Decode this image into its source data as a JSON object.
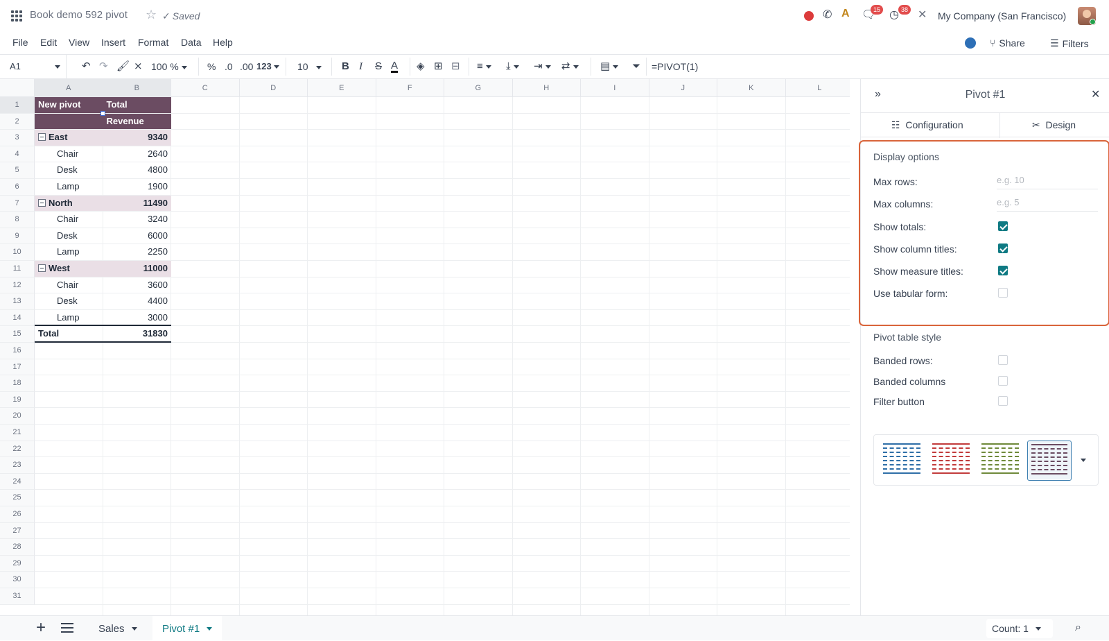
{
  "app": {
    "doc_title": "Book demo 592 pivot",
    "saved_status": "Saved",
    "company": "My Company (San Francisco)",
    "badges": {
      "messages": "15",
      "activities": "38"
    }
  },
  "menu": {
    "items": [
      "File",
      "Edit",
      "View",
      "Insert",
      "Format",
      "Data",
      "Help"
    ],
    "share": "Share",
    "filters": "Filters"
  },
  "toolbar": {
    "cell_ref": "A1",
    "zoom": "100 %",
    "percent": "%",
    "dec_less": ".0",
    "dec_more": ".00",
    "num_fmt": "123",
    "font_size": "10",
    "bold": "B",
    "italic": "I",
    "strike": "S",
    "text_color": "A",
    "formula": "=PIVOT(1)"
  },
  "grid": {
    "columns": [
      "A",
      "B",
      "C",
      "D",
      "E",
      "F",
      "G",
      "H",
      "I",
      "J",
      "K",
      "L"
    ],
    "row_numbers": [
      "1",
      "2",
      "3",
      "4",
      "5",
      "6",
      "7",
      "8",
      "9",
      "10",
      "11",
      "12",
      "13",
      "14",
      "15",
      "16",
      "17",
      "18",
      "19",
      "20",
      "21",
      "22",
      "23",
      "24",
      "25",
      "26",
      "27",
      "28",
      "29",
      "30",
      "31"
    ],
    "pivot": {
      "header_a1": "New pivot",
      "header_b1": "Total",
      "header_b2": "Revenue",
      "rows": [
        {
          "label": "East",
          "value": "9340",
          "type": "group"
        },
        {
          "label": "Chair",
          "value": "2640",
          "type": "item"
        },
        {
          "label": "Desk",
          "value": "4800",
          "type": "item"
        },
        {
          "label": "Lamp",
          "value": "1900",
          "type": "item"
        },
        {
          "label": "North",
          "value": "11490",
          "type": "group"
        },
        {
          "label": "Chair",
          "value": "3240",
          "type": "item"
        },
        {
          "label": "Desk",
          "value": "6000",
          "type": "item"
        },
        {
          "label": "Lamp",
          "value": "2250",
          "type": "item"
        },
        {
          "label": "West",
          "value": "11000",
          "type": "group"
        },
        {
          "label": "Chair",
          "value": "3600",
          "type": "item"
        },
        {
          "label": "Desk",
          "value": "4400",
          "type": "item"
        },
        {
          "label": "Lamp",
          "value": "3000",
          "type": "item"
        },
        {
          "label": "Total",
          "value": "31830",
          "type": "total"
        }
      ]
    }
  },
  "panel": {
    "title": "Pivot #1",
    "tabs": [
      "Configuration",
      "Design"
    ],
    "display_options": {
      "title": "Display options",
      "max_rows_label": "Max rows:",
      "max_rows_placeholder": "e.g. 10",
      "max_columns_label": "Max columns:",
      "max_columns_placeholder": "e.g. 5",
      "checks": [
        {
          "label": "Show totals:",
          "checked": true
        },
        {
          "label": "Show column titles:",
          "checked": true
        },
        {
          "label": "Show measure titles:",
          "checked": true
        },
        {
          "label": "Use tabular form:",
          "checked": false
        }
      ]
    },
    "table_style": {
      "title": "Pivot table style",
      "checks": [
        {
          "label": "Banded rows:",
          "checked": false
        },
        {
          "label": "Banded columns",
          "checked": false
        },
        {
          "label": "Filter button",
          "checked": false
        }
      ],
      "style_colors": [
        "#2f6fa8",
        "#c23b3b",
        "#6f8a3a",
        "#6b4c62"
      ],
      "selected_style": 3
    }
  },
  "bottom": {
    "sheets": [
      {
        "name": "Sales",
        "active": false
      },
      {
        "name": "Pivot #1",
        "active": true
      }
    ],
    "count": "Count: 1"
  },
  "colors": {
    "accent": "#0f7a83",
    "pivot_header": "#6b4c62",
    "pivot_group": "#eadfe6",
    "highlight_border": "#d9643a"
  }
}
